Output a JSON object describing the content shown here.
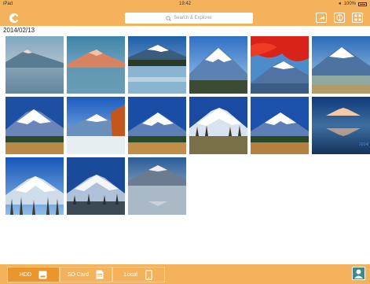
{
  "status": {
    "carrier": "iPad",
    "time": "19:42",
    "battery": "100%"
  },
  "toolbar": {
    "search_placeholder": "Search & Explorer"
  },
  "gallery": {
    "date_label": "2014/02/13",
    "side_label": "2014/"
  },
  "footer": {
    "tabs": [
      {
        "label": "HDD",
        "active": true
      },
      {
        "label": "SD Card",
        "active": false
      },
      {
        "label": "Local",
        "active": false
      }
    ]
  },
  "colors": {
    "bar": "#f4b25c",
    "active_tab": "#e9962f"
  },
  "icons": {
    "toolbar": [
      "back-icon",
      "share-icon",
      "info-icon",
      "grid-view-icon"
    ],
    "footer": [
      "hdd-icon",
      "sd-card-icon",
      "local-device-icon",
      "user-icon"
    ]
  }
}
